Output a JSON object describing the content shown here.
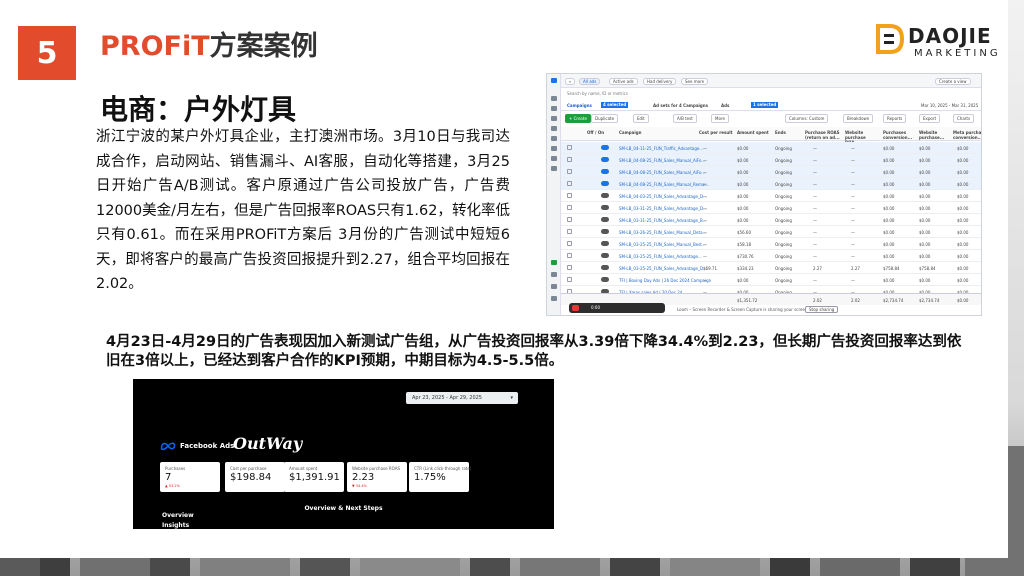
{
  "slide": {
    "number": "5",
    "title_accent": "PROFiT",
    "title_rest": "方案案例",
    "logo": {
      "name": "DAOJIE",
      "sub": "MARKETING"
    },
    "subtitle": "电商：户外灯具",
    "paragraph": "浙江宁波的某户外灯具企业，主打澳洲市场。3月10日与我司达成合作，启动网站、销售漏斗、AI客服，自动化等搭建，3月25日开始广告A/B测试。客户原通过广告公司投放广告，广告费12000美金/月左右，但是广告回报率ROAS只有1.62，转化率低只有0.61。而在采用PROFiT方案后 3月份的广告测试中短短6天，即将客户的最高广告投资回报提升到2.27，组合平均回报在2.02。",
    "summary": "4月23日-4月29日的广告表现因加入新测试广告组，从广告投资回报率从3.39倍下降34.4%到2.23，但长期广告投资回报率达到依旧在3倍以上，已经达到客户合作的KPI预期，中期目标为4.5-5.5倍。"
  },
  "ads_manager": {
    "topbar": {
      "chips": [
        "All ads",
        "Active ads",
        "Had delivery",
        "See more"
      ],
      "create_view": "Create a view",
      "search_placeholder": "Search by name, ID or metrics"
    },
    "tabs": {
      "campaigns": "Campaigns",
      "campaigns_badge": "4 selected",
      "adsets": "Ad sets for 4 Campaigns",
      "ads": "Ads",
      "ads_badge": "1 selected",
      "daterange": "Mar 10, 2025 - Mar 31, 2025"
    },
    "toolbar": {
      "create": "+ Create",
      "duplicate": "Duplicate",
      "edit": "Edit",
      "ab_test": "A/B test",
      "more": "More",
      "columns": "Columns: Custom",
      "breakdown": "Breakdown",
      "reports": "Reports",
      "export": "Export",
      "charts": "Charts"
    },
    "columns": [
      "Off / On",
      "Campaign",
      "Cost per result",
      "Amount spent",
      "Ends",
      "Purchase ROAS (return on ad...",
      "Website purchase ROA...",
      "Purchases conversion...",
      "Website purchase...",
      "Meta purchase conversion..."
    ],
    "rows": [
      {
        "name": "SM-LB_04-11-25_FUN_Traffic_Advantage...",
        "cost": "—",
        "spent": "$0.00",
        "ends": "Ongoing",
        "roas": "—",
        "wroas": "—",
        "conv": "$0.00",
        "wp": "$0.00",
        "meta": "$0.00",
        "on": true,
        "sel": true
      },
      {
        "name": "SM-LB_04-08-25_FUN_Sales_Manual_AiFo...",
        "cost": "—",
        "spent": "$0.00",
        "ends": "Ongoing",
        "roas": "—",
        "wroas": "—",
        "conv": "$0.00",
        "wp": "$0.00",
        "meta": "$0.00",
        "on": true,
        "sel": true
      },
      {
        "name": "SM-LB_04-08-25_FUN_Sales_Manual_AiFo...",
        "cost": "—",
        "spent": "$0.00",
        "ends": "Ongoing",
        "roas": "—",
        "wroas": "—",
        "conv": "$0.00",
        "wp": "$0.00",
        "meta": "$0.00",
        "on": true,
        "sel": true
      },
      {
        "name": "SM-LB_04-08-25_FUN_Sales_Manual_Remar...",
        "cost": "—",
        "spent": "$0.00",
        "ends": "Ongoing",
        "roas": "—",
        "wroas": "—",
        "conv": "$0.00",
        "wp": "$0.00",
        "meta": "$0.00",
        "on": true,
        "sel": true
      },
      {
        "name": "SM-LB_04-03-25_FUN_Sales_Advantage_D...",
        "cost": "—",
        "spent": "$0.00",
        "ends": "Ongoing",
        "roas": "—",
        "wroas": "—",
        "conv": "$0.00",
        "wp": "$0.00",
        "meta": "$0.00",
        "on": false,
        "sel": false
      },
      {
        "name": "SM-LB_03-31-25_FUN_Sales_Advantage_D...",
        "cost": "—",
        "spent": "$0.00",
        "ends": "Ongoing",
        "roas": "—",
        "wroas": "—",
        "conv": "$0.00",
        "wp": "$0.00",
        "meta": "$0.00",
        "on": false,
        "sel": false
      },
      {
        "name": "SM-LB_03-31-25_FUN_Sales_Advantage_B...",
        "cost": "—",
        "spent": "$0.00",
        "ends": "Ongoing",
        "roas": "—",
        "wroas": "—",
        "conv": "$0.00",
        "wp": "$0.00",
        "meta": "$0.00",
        "on": false,
        "sel": false
      },
      {
        "name": "SM-LB_03-26-25_FUN_Sales_Manual_Deta...",
        "cost": "—",
        "spent": "$56.60",
        "ends": "Ongoing",
        "roas": "—",
        "wroas": "—",
        "conv": "$0.00",
        "wp": "$0.00",
        "meta": "$0.00",
        "on": false,
        "sel": false
      },
      {
        "name": "SM-LB_03-25-25_FUN_Sales_Manual_Best...",
        "cost": "—",
        "spent": "$58.18",
        "ends": "Ongoing",
        "roas": "—",
        "wroas": "—",
        "conv": "$0.00",
        "wp": "$0.00",
        "meta": "$0.00",
        "on": false,
        "sel": false
      },
      {
        "name": "SM-LB_03-25-25_FUN_Sales_Advantage...",
        "cost": "—",
        "spent": "$730.76",
        "ends": "Ongoing",
        "roas": "—",
        "wroas": "—",
        "conv": "$0.00",
        "wp": "$0.00",
        "meta": "$0.00",
        "on": false,
        "sel": false
      },
      {
        "name": "SM-LB_03-25-25_FUN_Sales_Advantage_D...",
        "cost": "$69.71",
        "spent": "$334.23",
        "ends": "Ongoing",
        "roas": "2.27",
        "wroas": "2.27",
        "conv": "$758.84",
        "wp": "$758.84",
        "meta": "$0.00",
        "on": false,
        "sel": false
      },
      {
        "name": "TFI | Boxing Day Ads | 26 Dec 2024 Campaign",
        "cost": "—",
        "spent": "$0.00",
        "ends": "Ongoing",
        "roas": "—",
        "wroas": "—",
        "conv": "$0.00",
        "wp": "$0.00",
        "meta": "$0.00",
        "on": false,
        "sel": false
      },
      {
        "name": "TFI | Xmas sales Ad | 20 Dec 24",
        "cost": "—",
        "spent": "$0.00",
        "ends": "Ongoing",
        "roas": "—",
        "wroas": "—",
        "conv": "$0.00",
        "wp": "$0.00",
        "meta": "$0.00",
        "on": false,
        "sel": false
      }
    ],
    "totals": {
      "spent": "$1,351.72",
      "roas": "2.02",
      "wroas": "2.02",
      "conv": "$2,734.74",
      "wp": "$2,734.74",
      "meta": "$0.00"
    },
    "recorder": {
      "time": "0:00",
      "notice": "Loom – Screen Recorder & Screen Capture is sharing your screen.",
      "stop": "Stop sharing"
    }
  },
  "report": {
    "daterange": "Apr 23, 2025 - Apr 29, 2025",
    "facebook_ads": "Facebook Ads",
    "brand": "OutWay",
    "kpis": [
      {
        "label": "Purchases",
        "value": "7",
        "change": "▲ 53.2%"
      },
      {
        "label": "Cost per purchase",
        "value": "$198.84",
        "change": ""
      },
      {
        "label": "Amount spent",
        "value": "$1,391.91",
        "change": ""
      },
      {
        "label": "Website purchase ROAS",
        "value": "2.23",
        "change": "▼ 34.4%"
      },
      {
        "label": "CTR (Link click-through rate)",
        "value": "1.75%",
        "change": ""
      }
    ],
    "section_title": "Overview & Next Steps",
    "nav": [
      "Overview",
      "Insights"
    ]
  },
  "colors": {
    "accent": "#e24b2b",
    "meta_blue": "#0866ff",
    "create_green": "#1f9d3a"
  }
}
